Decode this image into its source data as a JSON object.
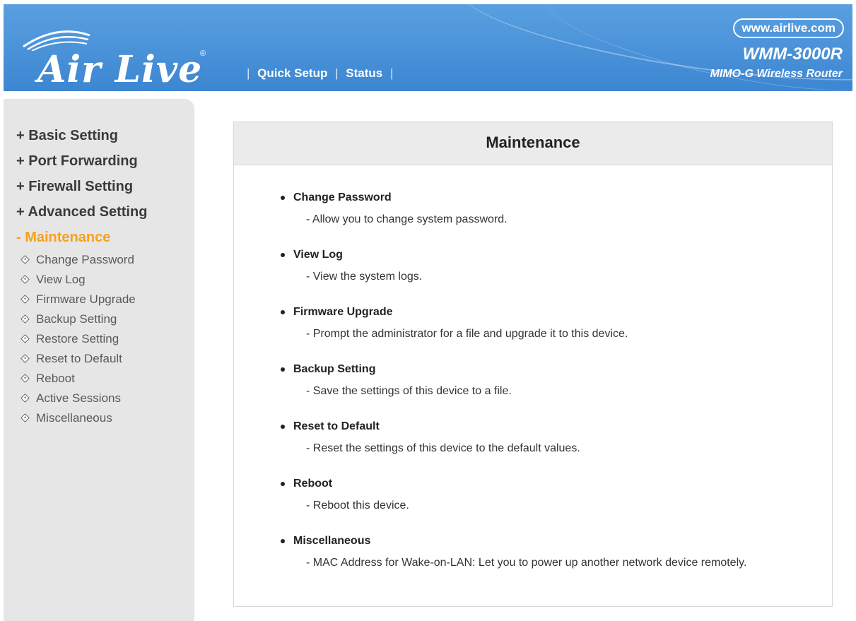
{
  "header": {
    "brand": "Air Live",
    "reg_mark": "®",
    "nav": [
      {
        "label": "Quick Setup"
      },
      {
        "label": "Status"
      }
    ],
    "url": "www.airlive.com",
    "model": "WMM-3000R",
    "product": "MIMO-G Wireless Router",
    "colors": {
      "header_bg": "#4a93da",
      "accent": "#f7a11a"
    }
  },
  "sidebar": {
    "sections": [
      {
        "label": "+ Basic Setting",
        "active": false
      },
      {
        "label": "+ Port Forwarding",
        "active": false
      },
      {
        "label": "+ Firewall Setting",
        "active": false
      },
      {
        "label": "+ Advanced Setting",
        "active": false
      },
      {
        "label": "- Maintenance",
        "active": true
      }
    ],
    "sub_items": [
      {
        "label": "Change Password"
      },
      {
        "label": "View Log"
      },
      {
        "label": "Firmware Upgrade"
      },
      {
        "label": "Backup Setting"
      },
      {
        "label": "Restore Setting"
      },
      {
        "label": "Reset to Default"
      },
      {
        "label": "Reboot"
      },
      {
        "label": "Active Sessions"
      },
      {
        "label": "Miscellaneous"
      }
    ]
  },
  "main": {
    "title": "Maintenance",
    "items": [
      {
        "title": "Change Password",
        "desc": "- Allow you to change system password."
      },
      {
        "title": "View Log",
        "desc": "- View the system logs."
      },
      {
        "title": "Firmware Upgrade",
        "desc": "- Prompt the administrator for a file and upgrade it to this device."
      },
      {
        "title": "Backup Setting",
        "desc": "- Save the settings of this device to a file."
      },
      {
        "title": "Reset to Default",
        "desc": "- Reset the settings of this device to the default values."
      },
      {
        "title": "Reboot",
        "desc": "- Reboot this device."
      },
      {
        "title": "Miscellaneous",
        "desc": "- MAC Address for Wake-on-LAN: Let you to power up another network device remotely."
      }
    ]
  }
}
